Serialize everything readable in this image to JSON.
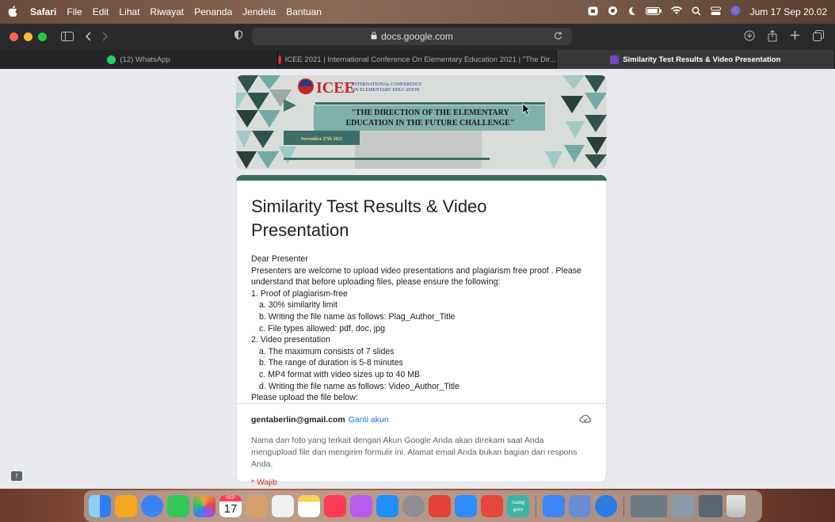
{
  "menubar": {
    "apple": "",
    "items": [
      "Safari",
      "File",
      "Edit",
      "Lihat",
      "Riwayat",
      "Penanda",
      "Jendela",
      "Bantuan"
    ],
    "clock": "Jum 17 Sep 20.02"
  },
  "toolbar": {
    "url": "docs.google.com"
  },
  "tabs": [
    {
      "label": "(12) WhatsApp",
      "color": "#25d366"
    },
    {
      "label": "ICEE 2021 | International Conference On Elementary Education 2021 | \"The Dir...",
      "color": "#d33"
    },
    {
      "label": "Similarity Test Results & Video Presentation",
      "color": "#7248b9"
    }
  ],
  "banner": {
    "logo_text": "ICEE",
    "org_line1": "INTERNATIONAL CONFERENCE",
    "org_line2": "ON ELEMENTARY EDUCATION",
    "theme_line1": "\"THE DIRECTION OF THE ELEMENTARY",
    "theme_line2": "EDUCATION IN THE FUTURE CHALLENGE\"",
    "date": "November 27th 2021"
  },
  "form": {
    "title": "Similarity Test Results & Video Presentation",
    "desc": [
      {
        "t": "Dear Presenter",
        "ind": false
      },
      {
        "t": "Presenters are welcome to upload video presentations and plagiarism free proof . Please understand that before uploading files, please ensure the following:",
        "ind": false
      },
      {
        "t": "1. Proof of plagiarism-free",
        "ind": false
      },
      {
        "t": "a. 30% similarity limit",
        "ind": true
      },
      {
        "t": "b. Writing the file name as follows: Plag_Author_Title",
        "ind": true
      },
      {
        "t": "c. File types allowed: pdf, doc, jpg",
        "ind": true
      },
      {
        "t": "2. Video presentation",
        "ind": false
      },
      {
        "t": "a. The maximum consists of 7 slides",
        "ind": true
      },
      {
        "t": "b. The range of duration is 5-8 minutes",
        "ind": true
      },
      {
        "t": "c. MP4 format with video sizes up to 40 MB",
        "ind": true
      },
      {
        "t": "d. Writing the file name as follows: Video_Author_Title",
        "ind": true
      },
      {
        "t": "Please upload the file below:",
        "ind": false
      }
    ],
    "email": "gentaberlin@gmail.com",
    "switch_account": "Ganti akun",
    "note": "Nama dan foto yang terkait dengan Akun Google Anda akan direkam saat Anda mengupload file dan mengirim formulir ini. Alamat email Anda bukan bagian dari respons Anda.",
    "required": "* Wajib"
  },
  "dock": {
    "calendar_month": "SEP",
    "calendar_day": "17",
    "ruang_guru_label": "ruang guru",
    "apps": [
      "#2e7df6",
      "#f5a623",
      "#3b82f6",
      "#34c759",
      "#f2a13b",
      "#e8e8e8",
      "#d4a070",
      "#f0f0f0",
      "#f7d154",
      "#fb3e54",
      "#b85cf0",
      "#1e90ff",
      "#8e8e93",
      "#e34234",
      "#2d8cff",
      "#e6483d",
      "#3bb4a3",
      "#3d86f5",
      "#6b8ed6",
      "#2b7be0",
      "#6d7b86",
      "#8b9aa8",
      "#c0c0c0"
    ]
  }
}
